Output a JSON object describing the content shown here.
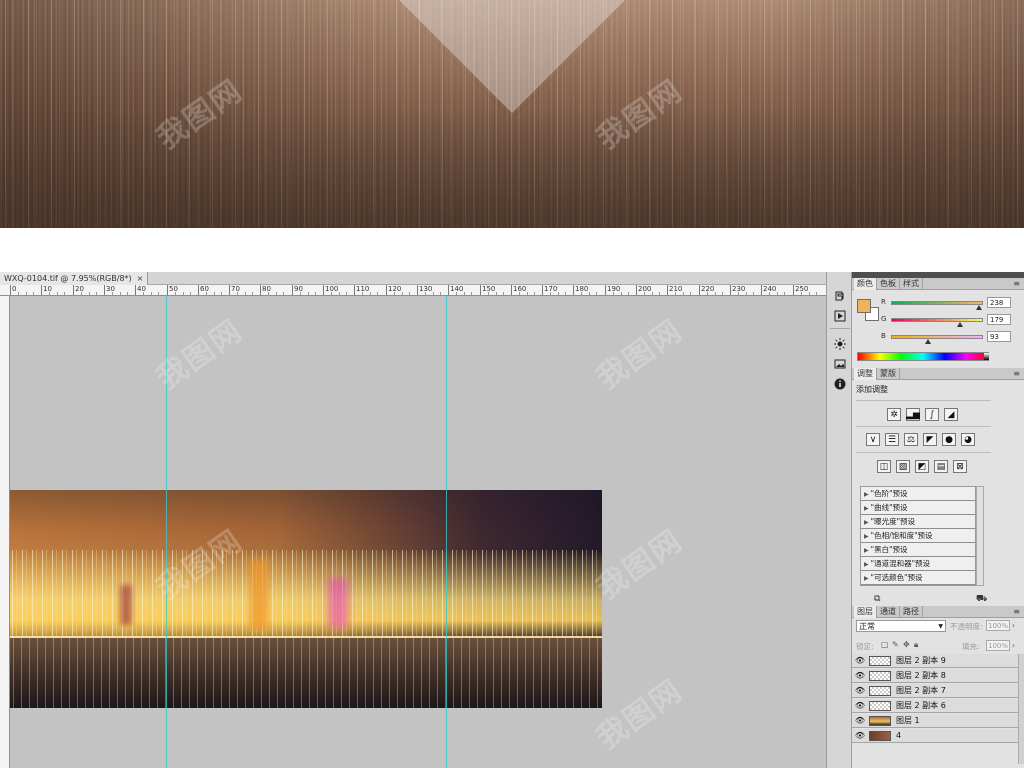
{
  "document": {
    "tab_title": "WXQ-0104.tif @ 7.95%(RGB/8*)",
    "close_glyph": "×",
    "ruler_labels": [
      "0",
      "10",
      "20",
      "30",
      "40",
      "50",
      "60",
      "70",
      "80",
      "90",
      "100",
      "110",
      "120",
      "130",
      "140",
      "150",
      "160",
      "170",
      "180",
      "190",
      "200",
      "210",
      "220",
      "230",
      "240",
      "250"
    ]
  },
  "toolstrip": {
    "icons": [
      "layers-history-icon",
      "play-actions-icon",
      "brightness-adjust-icon",
      "navigator-icon",
      "info-icon"
    ]
  },
  "color_panel": {
    "tabs": [
      "颜色",
      "色板",
      "样式"
    ],
    "foreground_color": "#eeb35d",
    "background_color": "#ffffff",
    "r": {
      "label": "R",
      "value": "238"
    },
    "g": {
      "label": "G",
      "value": "179"
    },
    "b": {
      "label": "B",
      "value": "93"
    }
  },
  "adjustments_panel": {
    "tabs": [
      "调整",
      "蒙版"
    ],
    "title": "添加调整",
    "presets": [
      "\"色阶\"预设",
      "\"曲线\"预设",
      "\"曝光度\"预设",
      "\"色相/饱和度\"预设",
      "\"黑白\"预设",
      "\"通道混和器\"预设",
      "\"可选颜色\"预设"
    ]
  },
  "layers_panel": {
    "tabs": [
      "图层",
      "通道",
      "路径"
    ],
    "blend_mode": "正常",
    "opacity_label": "不透明度:",
    "opacity_value": "100%",
    "lock_label": "锁定:",
    "fill_label": "填充:",
    "fill_value": "100%",
    "layers": [
      {
        "name": "图层 2 副本 9",
        "thumb": "transparent"
      },
      {
        "name": "图层 2 副本 8",
        "thumb": "transparent"
      },
      {
        "name": "图层 2 副本 7",
        "thumb": "transparent"
      },
      {
        "name": "图层 2 副本 6",
        "thumb": "transparent"
      },
      {
        "name": "图层 1",
        "thumb": "artwork"
      },
      {
        "name": "4",
        "thumb": "base"
      }
    ]
  },
  "watermark": "我图网"
}
